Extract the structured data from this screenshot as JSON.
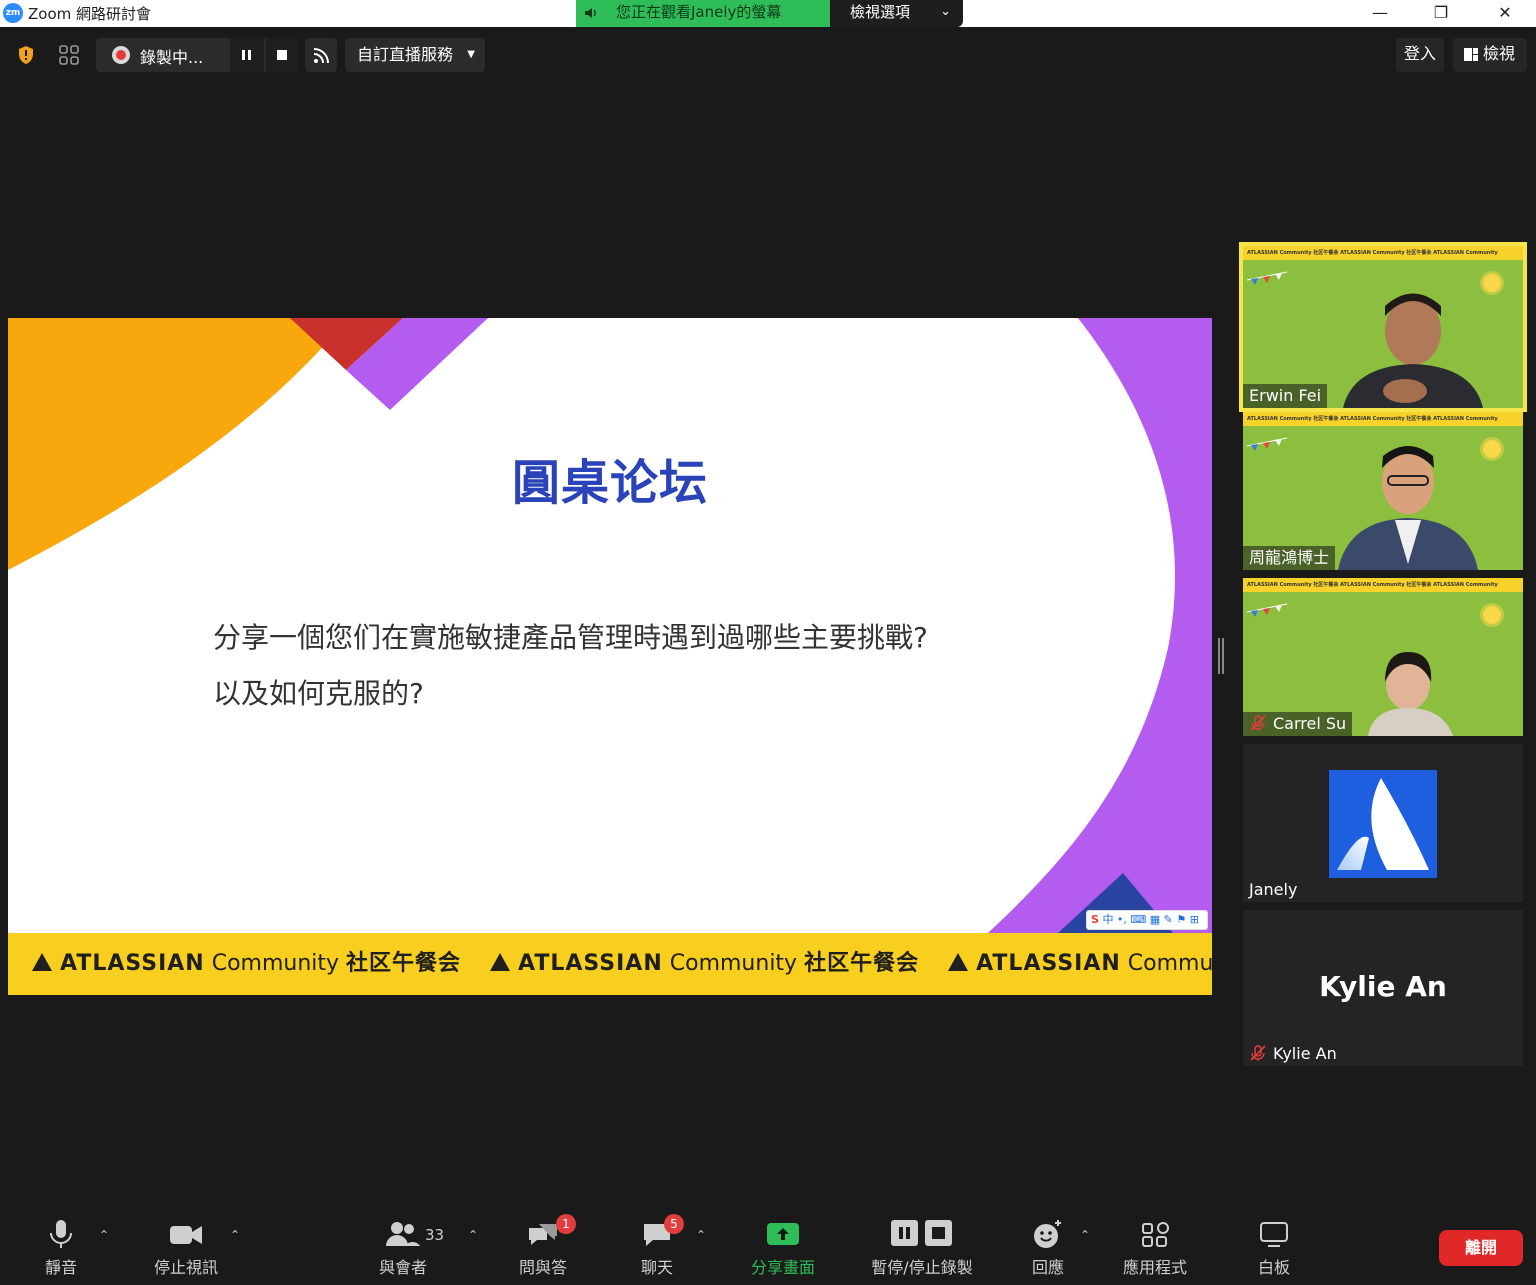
{
  "window": {
    "app_title": "Zoom 網路研討會",
    "logo_text": "zm",
    "share_banner": "您正在觀看Janely的螢幕",
    "view_options": "檢視選項"
  },
  "top_toolbar": {
    "recording_label": "錄製中...",
    "live_stream_label": "自訂直播服務",
    "sign_in_label": "登入",
    "view_label": "檢視"
  },
  "slide": {
    "title": "圓桌论坛",
    "question_line1": "分享一個您们在實施敏捷產品管理時遇到過哪些主要挑戰?",
    "question_line2": "以及如何克服的?",
    "ime_toolbar": "中 •, ⌨ ▦ ✎ ⚑ ⊞",
    "footer_items": [
      {
        "brand": "ATLASSIAN",
        "community": "Community",
        "suffix": "社区午餐会"
      },
      {
        "brand": "ATLASSIAN",
        "community": "Community",
        "suffix": "社区午餐会"
      },
      {
        "brand": "ATLASSIAN",
        "community": "Community",
        "suffix": ""
      }
    ]
  },
  "participants": [
    {
      "name": "Erwin Fei",
      "muted": false,
      "speaking": true
    },
    {
      "name": "周龍鴻博士",
      "muted": false,
      "speaking": false
    },
    {
      "name": "Carrel Su",
      "muted": true,
      "speaking": false
    },
    {
      "name": "Janely",
      "muted": false,
      "speaking": false
    },
    {
      "name": "Kylie An",
      "display_name": "Kylie An",
      "muted": true,
      "speaking": false
    }
  ],
  "tile_band_text": "ATLASSIAN Community 社区午餐会   ATLASSIAN Community 社区午餐会   ATLASSIAN Community",
  "bottom_toolbar": {
    "mute": "靜音",
    "stop_video": "停止視訊",
    "participants": "與會者",
    "participants_count": "33",
    "qa": "問與答",
    "qa_badge": "1",
    "chat": "聊天",
    "chat_badge": "5",
    "share_screen": "分享畫面",
    "pause_stop_record": "暫停/停止錄製",
    "reactions": "回應",
    "apps": "應用程式",
    "whiteboard": "白板",
    "leave": "離開"
  },
  "colors": {
    "zoom_blue": "#2d8cff",
    "share_green": "#2ebd59",
    "leave_red": "#e02828",
    "title_blue": "#2a43b8",
    "active_speaker": "#f5e44a",
    "band_yellow": "#f9cf1f"
  }
}
